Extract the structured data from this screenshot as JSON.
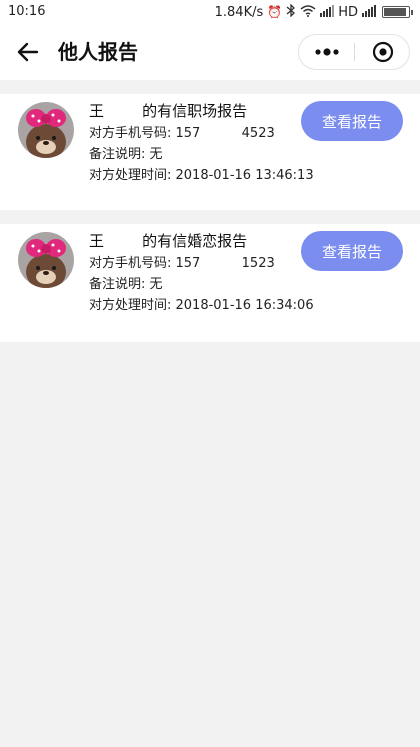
{
  "status_bar": {
    "time": "10:16",
    "speed": "1.84K/s",
    "network": "HD"
  },
  "header": {
    "title": "他人报告"
  },
  "reports": [
    {
      "title": "王        的有信职场报告",
      "phone_label": "对方手机号码: ",
      "phone_value": "157          4523",
      "remark_label": "备注说明: ",
      "remark_value": "无",
      "time_label": "对方处理时间: ",
      "time_value": "2018-01-16 13:46:13",
      "button_label": "查看报告"
    },
    {
      "title": "王        的有信婚恋报告",
      "phone_label": "对方手机号码: ",
      "phone_value": "157          1523",
      "remark_label": "备注说明: ",
      "remark_value": "无",
      "time_label": "对方处理时间: ",
      "time_value": "2018-01-16 16:34:06",
      "button_label": "查看报告"
    }
  ],
  "colors": {
    "button": "#7b8ef0",
    "background": "#f2f2f2"
  }
}
